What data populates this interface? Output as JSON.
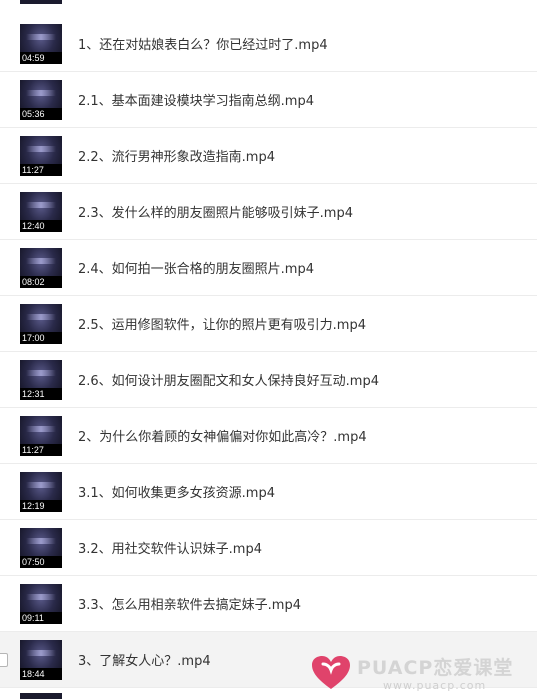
{
  "files": [
    {
      "name": "1、还在对姑娘表白么？你已经过时了.mp4",
      "duration": "04:59"
    },
    {
      "name": "2.1、基本面建设模块学习指南总纲.mp4",
      "duration": "05:36"
    },
    {
      "name": "2.2、流行男神形象改造指南.mp4",
      "duration": "11:27"
    },
    {
      "name": "2.3、发什么样的朋友圈照片能够吸引妹子.mp4",
      "duration": "12:40"
    },
    {
      "name": "2.4、如何拍一张合格的朋友圈照片.mp4",
      "duration": "08:02"
    },
    {
      "name": "2.5、运用修图软件，让你的照片更有吸引力.mp4",
      "duration": "17:00"
    },
    {
      "name": "2.6、如何设计朋友圈配文和女人保持良好互动.mp4",
      "duration": "12:31"
    },
    {
      "name": "2、为什么你着顾的女神偏偏对你如此高冷？.mp4",
      "duration": "11:27"
    },
    {
      "name": "3.1、如何收集更多女孩资源.mp4",
      "duration": "12:19"
    },
    {
      "name": "3.2、用社交软件认识妹子.mp4",
      "duration": "07:50"
    },
    {
      "name": "3.3、怎么用相亲软件去搞定妹子.mp4",
      "duration": "09:11"
    },
    {
      "name": "3、了解女人心？.mp4",
      "duration": "18:44"
    }
  ],
  "watermark": {
    "brand": "PUACP恋爱课堂",
    "url": "www.puacp.com",
    "heart_color": "#e0436b"
  }
}
